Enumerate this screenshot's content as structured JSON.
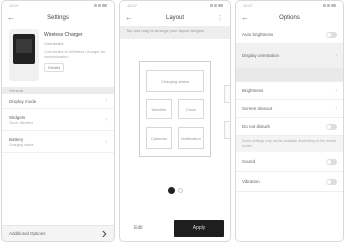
{
  "screens": {
    "device_settings": {
      "status_time": "10:07",
      "title": "Settings",
      "device": {
        "name": "Wireless Charger",
        "subtitle": "Connected",
        "description": "Connected to Wireless Charger for customization.",
        "button_label": "Details"
      },
      "section_label": "General",
      "rows": [
        {
          "label": "Display mode",
          "sub": ""
        },
        {
          "label": "Widgets",
          "sub": "Clock, Weather"
        },
        {
          "label": "Battery",
          "sub": "Charging status"
        },
        {
          "label": "Additional Options",
          "sub": ""
        }
      ]
    },
    "layout_editor": {
      "status_time": "10:07",
      "title": "Layout",
      "hint": "Tap and drag to arrange your layout widgets",
      "cells": [
        "Charging status",
        "Weather",
        "Clock",
        "Calendar",
        "Notification"
      ],
      "cancel_label": "Edit",
      "apply_label": "Apply"
    },
    "options": {
      "status_time": "10:07",
      "title": "Options",
      "rows": [
        {
          "label": "Auto brightness",
          "value": ""
        },
        {
          "label": "Display orientation",
          "value": ""
        },
        {
          "label": "Brightness",
          "value": ""
        },
        {
          "label": "Screen timeout",
          "value": ""
        },
        {
          "label": "Do not disturb",
          "value": ""
        },
        {
          "label": "Sound",
          "value": ""
        },
        {
          "label": "Vibration",
          "value": ""
        }
      ],
      "note": "Some settings may not be available depending on the device model."
    }
  },
  "icons": {
    "back": "back-arrow-icon",
    "chevron": "chevron-right-icon",
    "more": "more-icon"
  }
}
